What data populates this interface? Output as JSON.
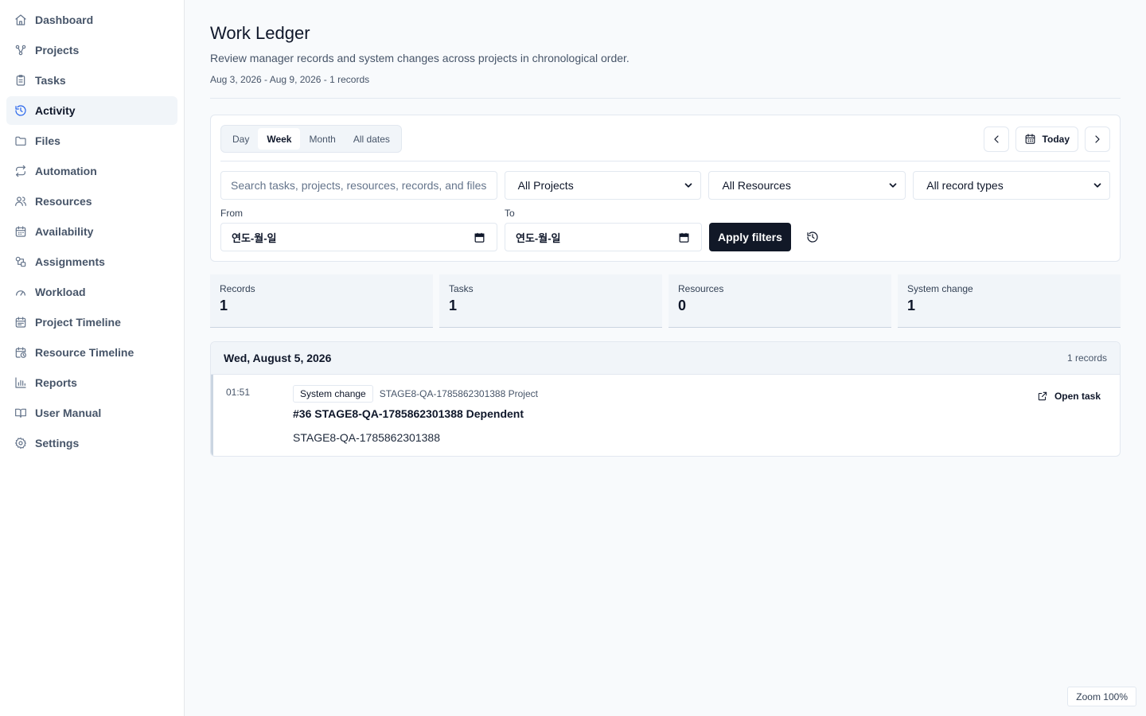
{
  "sidebar": {
    "items": [
      {
        "label": "Dashboard",
        "icon": "home-icon"
      },
      {
        "label": "Projects",
        "icon": "project-network-icon"
      },
      {
        "label": "Tasks",
        "icon": "clipboard-icon"
      },
      {
        "label": "Activity",
        "icon": "history-icon"
      },
      {
        "label": "Files",
        "icon": "folder-icon"
      },
      {
        "label": "Automation",
        "icon": "repeat-icon"
      },
      {
        "label": "Resources",
        "icon": "users-icon"
      },
      {
        "label": "Availability",
        "icon": "calendar-icon"
      },
      {
        "label": "Assignments",
        "icon": "shapes-icon"
      },
      {
        "label": "Workload",
        "icon": "gauge-icon"
      },
      {
        "label": "Project Timeline",
        "icon": "calendar-range-icon"
      },
      {
        "label": "Resource Timeline",
        "icon": "calendar-clock-icon"
      },
      {
        "label": "Reports",
        "icon": "bar-chart-icon"
      },
      {
        "label": "User Manual",
        "icon": "book-icon"
      },
      {
        "label": "Settings",
        "icon": "gear-icon"
      }
    ],
    "active": "Activity"
  },
  "header": {
    "title": "Work Ledger",
    "subtitle": "Review manager records and system changes across projects in chronological order.",
    "range": "Aug 3, 2026 - Aug 9, 2026 - 1 records"
  },
  "filters": {
    "tabs": [
      "Day",
      "Week",
      "Month",
      "All dates"
    ],
    "active_tab": "Week",
    "today_label": "Today",
    "search_placeholder": "Search tasks, projects, resources, records, and files",
    "project_select": "All Projects",
    "resource_select": "All Resources",
    "type_select": "All record types",
    "from_label": "From",
    "to_label": "To",
    "from_value": "연도-월-일",
    "to_value": "연도-월-일",
    "apply_label": "Apply filters"
  },
  "stats": [
    {
      "label": "Records",
      "value": "1"
    },
    {
      "label": "Tasks",
      "value": "1"
    },
    {
      "label": "Resources",
      "value": "0"
    },
    {
      "label": "System change",
      "value": "1"
    }
  ],
  "group": {
    "date": "Wed, August 5, 2026",
    "count": "1 records",
    "records": [
      {
        "time": "01:51",
        "badge": "System change",
        "project": "STAGE8-QA-1785862301388 Project",
        "title": "#36 STAGE8-QA-1785862301388 Dependent",
        "desc": "STAGE8-QA-1785862301388",
        "action": "Open task"
      }
    ]
  },
  "zoom": "Zoom 100%",
  "colors": {
    "accent": "#2563eb",
    "primary_button": "#111827"
  }
}
